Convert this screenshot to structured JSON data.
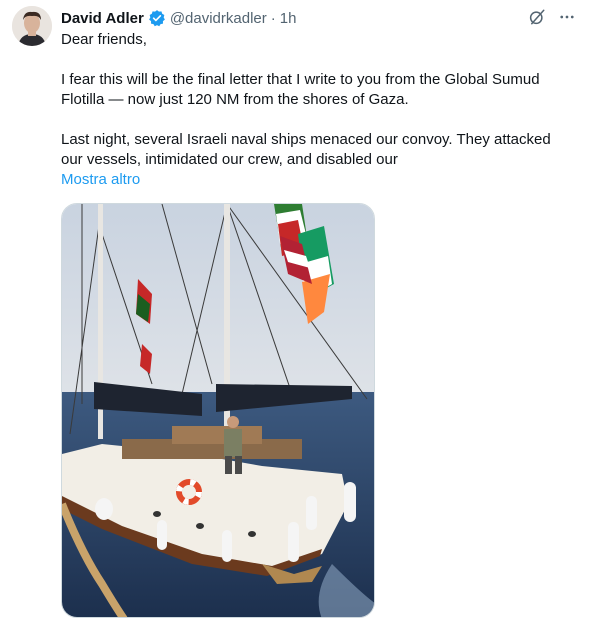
{
  "tweet": {
    "author_name": "David Adler",
    "author_handle": "@davidrkadler",
    "separator": "·",
    "timestamp": "1h",
    "text": {
      "line1": "Dear friends,",
      "paragraph2": "I fear this will be the final letter that I write to you from the Global Sumud Flotilla — now just 120 NM from the shores of Gaza.",
      "paragraph3": "Last night, several Israeli naval ships menaced our convoy. They attacked our vessels, intimidated our crew, and disabled our"
    },
    "show_more_label": "Mostra altro",
    "media": {
      "description_icon": "photo-of-sailboat-with-flags"
    }
  },
  "icons": {
    "verified": "verified-badge-icon",
    "grok": "grok-icon",
    "more": "more-horizontal-icon"
  },
  "colors": {
    "link": "#1d9bf0",
    "secondary_text": "#536471",
    "verified_blue": "#1d9bf0"
  }
}
